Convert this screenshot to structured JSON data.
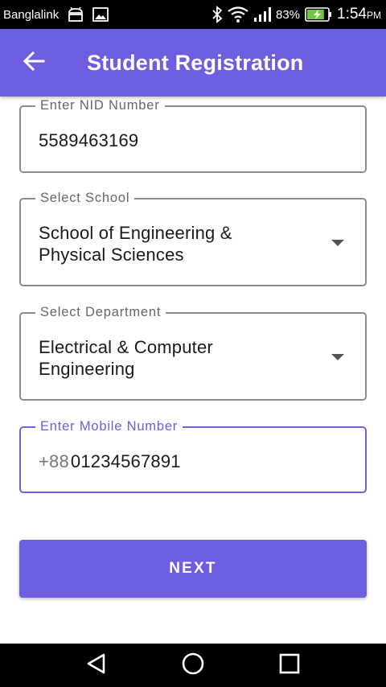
{
  "status_bar": {
    "carrier": "Banglalink",
    "battery_percent": "83%",
    "time": "1:54",
    "time_suffix": "PM",
    "battery_level": 0.83
  },
  "app_bar": {
    "title": "Student Registration",
    "background": "#6c5fdf"
  },
  "form": {
    "nid": {
      "label": "Enter NID Number",
      "value": "5589463169"
    },
    "school": {
      "label": "Select School",
      "value_line1": "School of Engineering &",
      "value_line2": "Physical Sciences"
    },
    "department": {
      "label": "Select Department",
      "value_line1": "Electrical & Computer",
      "value_line2": "Engineering"
    },
    "mobile": {
      "label": "Enter Mobile Number",
      "prefix": "+88",
      "value": "01234567891"
    }
  },
  "next_button": {
    "label": "NEXT"
  },
  "icons": {
    "back": "arrow-back-icon",
    "nav_back": "triangle-back-icon",
    "nav_home": "circle-home-icon",
    "nav_recents": "square-recents-icon"
  },
  "colors": {
    "accent": "#6c5fdf",
    "outline": "#8c8c8c"
  }
}
